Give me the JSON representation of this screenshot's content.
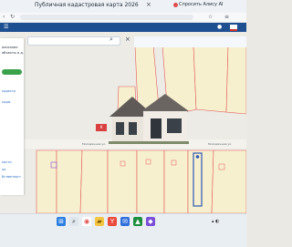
{
  "browser": {
    "tab_title": "Публичная кадастровая карта 2026",
    "tab_close": "×",
    "extension_label": "Спросить Алису AI"
  },
  "map": {
    "street_labels": [
      "Молодёжная ул.",
      "Молодёжная ул.",
      "Молодёжная ул."
    ]
  },
  "panel": {
    "lines": [
      "описание",
      "объекты и д.",
      "",
      "",
      "кадастр",
      "",
      "",
      "ходы",
      "",
      "",
      "",
      "",
      "",
      "",
      "",
      "ности",
      "",
      "ки",
      "",
      "",
      "бственност"
    ]
  },
  "popup_tag": "К",
  "colors": {
    "header": "#1d4f91",
    "parcel_fill": "#f7f0cf",
    "parcel_stroke": "#e35b5b",
    "selected_stroke": "#2f55b4",
    "panel_button": "#3aa24b"
  },
  "icons": [
    "search-icon",
    "close-icon",
    "windows-start-icon",
    "search-taskbar-icon",
    "browser-icon",
    "folder-icon",
    "yandex-icon",
    "mail-icon"
  ]
}
